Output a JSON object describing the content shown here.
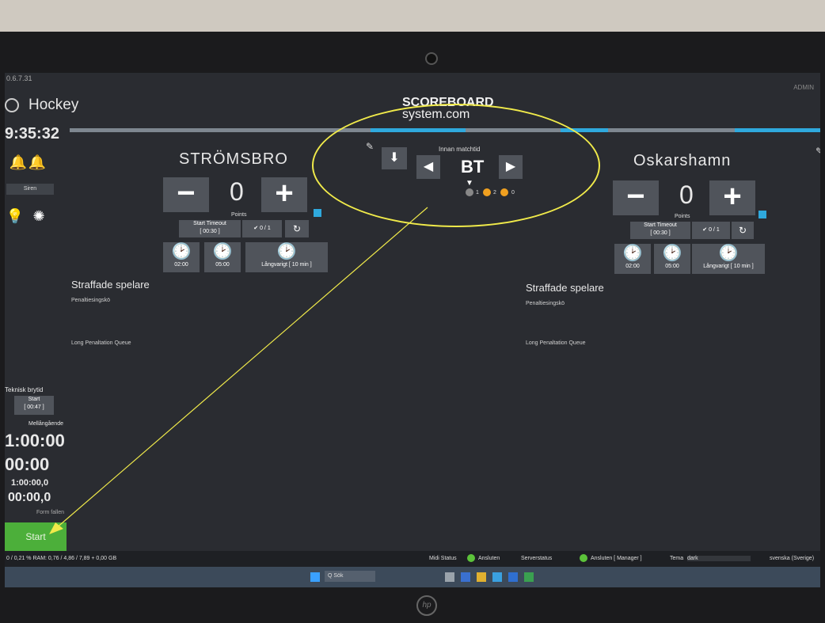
{
  "app": {
    "version": "0.6.7.31",
    "top_right": "ADMIN",
    "sport": "Hockey",
    "clock": "9:35:32"
  },
  "logo": {
    "line1": "SCOREBOARD",
    "line2": "system.com"
  },
  "home": {
    "name": "STRÖMSBRO",
    "score": "0",
    "points_label": "Points",
    "timeout_label": "Start Timeout",
    "timeout_time": "[ 00:30 ]",
    "timeouts": "0 / 1",
    "pen_2": "02:00",
    "pen_5": "05:00",
    "pen_10": "Långvarigt [ 10 min ]",
    "penalty_title": "Straffade spelare",
    "penalty_sub": "Penaltiesingskö",
    "queue": "Long Penaltation Queue"
  },
  "away": {
    "name": "Oskarshamn",
    "score": "0",
    "points_label": "Points",
    "timeout_label": "Start Timeout",
    "timeout_time": "[ 00:30 ]",
    "timeouts": "0 / 1",
    "pen_2": "02:00",
    "pen_5": "05:00",
    "pen_10": "Långvarigt [ 10 min ]",
    "penalty_title": "Straffade spelare",
    "penalty_sub": "Penaltiesingskö",
    "queue": "Long Penaltation Queue"
  },
  "center": {
    "label": "Innan matchtid",
    "period": "BT",
    "periods": [
      "1",
      "2",
      "0"
    ]
  },
  "sidebar": {
    "btn1": "Goal",
    "btn2": "Long Horn",
    "btn3": "Siren",
    "btn4": "Lightbulb",
    "btn5": "Queue"
  },
  "left": {
    "tech_label": "Teknisk brytid",
    "tech_start": "Start",
    "tech_time": "[ 00:47 ]",
    "mellan": "Mellångående",
    "big1": "1:00:00",
    "big2": "00:00",
    "small1": "1:00:00,0",
    "small2": "00:00,0",
    "form_label": "Form fallen",
    "start": "Start"
  },
  "status": {
    "perf": "0 / 0,21 % RAM: 0,76 / 4,86 / 7,89 + 0,00 GB",
    "midi": "Midi Status",
    "connected": "Ansluten",
    "server": "Serverstatus",
    "server_conn": "Ansluten [ Manager ]",
    "theme_label": "Tema",
    "theme": "dark",
    "lang": "svenska (Sverige)"
  },
  "taskbar": {
    "search": "Q Sök"
  },
  "colors": {
    "accent": "#2fa9dd",
    "green": "#4caf3a",
    "annotation": "#f0ea4a",
    "dot_gray": "#888888",
    "dot_orange": "#f0a020"
  }
}
